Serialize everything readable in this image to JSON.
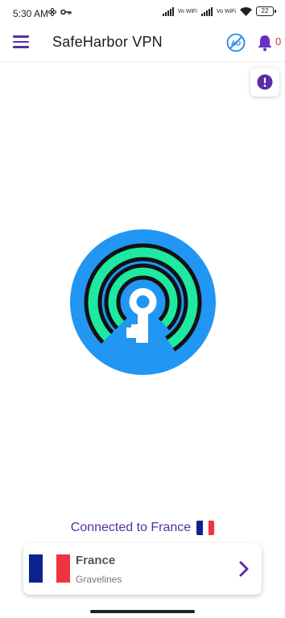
{
  "status_bar": {
    "time": "5:30 AM",
    "sim1_label": "Vo WiFi",
    "sim2_label": "Vo WiFi",
    "battery": "22"
  },
  "app_bar": {
    "title": "SafeHarbor VPN",
    "notification_count": "0"
  },
  "connection": {
    "status_text": "Connected to France"
  },
  "server": {
    "country": "France",
    "city": "Gravelines"
  },
  "colors": {
    "brand_purple": "#5a2ea6",
    "logo_blue": "#2196f3",
    "logo_green": "#1de9a0",
    "flag_blue": "#0a2390",
    "flag_red": "#ef3340"
  },
  "icons": [
    "menu-icon",
    "no-ads-icon",
    "bell-icon",
    "alert-icon",
    "vpn-key-logo",
    "chevron-right-icon"
  ]
}
